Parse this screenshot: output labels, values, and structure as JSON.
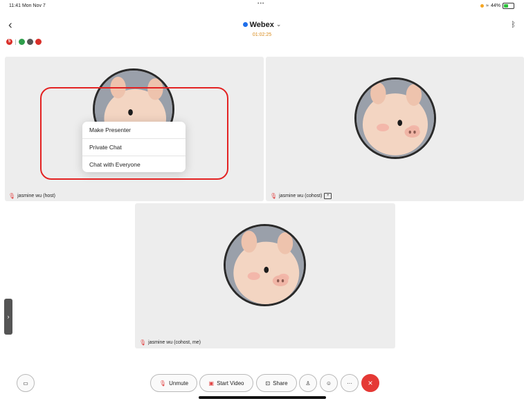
{
  "status_bar": {
    "time": "11:41  Mon Nov 7",
    "battery": "44%",
    "dots": "•••"
  },
  "header": {
    "title": "Webex",
    "timer": "01:02:25"
  },
  "participant_badges": [
    "5",
    "",
    "",
    ""
  ],
  "tiles": [
    {
      "name": "jasmine wu (host)"
    },
    {
      "name": "jasmine wu (cohost)"
    },
    {
      "name": "jasmine wu (cohost, me)"
    }
  ],
  "context_menu": {
    "items": [
      "Make Presenter",
      "Private Chat",
      "Chat with Everyone"
    ]
  },
  "toolbar": {
    "unmute": "Unmute",
    "start_video": "Start Video",
    "share": "Share",
    "more": "···",
    "end": "×"
  },
  "colors": {
    "accent_red": "#e32222",
    "webex_blue": "#1f6feb",
    "end_call": "#e53935",
    "timer_orange": "#d88a1a"
  },
  "icons": {
    "back": "chevron-left-icon",
    "bluetooth": "bluetooth-icon",
    "mic_muted": "mic-muted-icon",
    "video_off": "video-off-icon",
    "share": "share-screen-icon",
    "participants": "participants-icon",
    "reactions": "emoji-icon",
    "chat": "chat-icon"
  }
}
